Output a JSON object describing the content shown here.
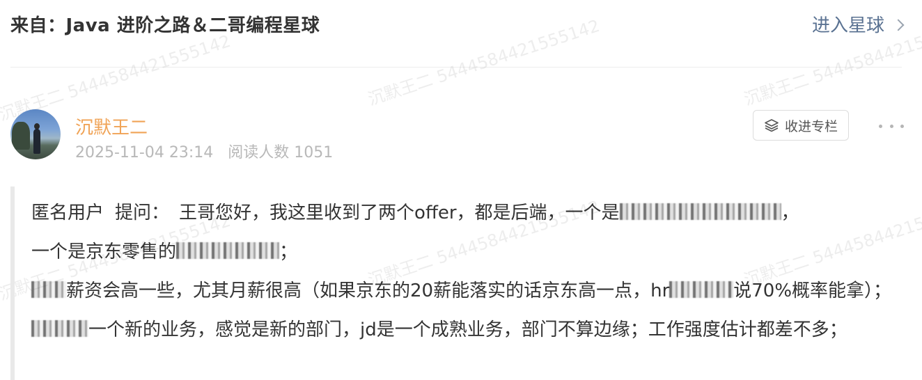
{
  "header": {
    "from_text": "来自：Java 进阶之路＆二哥编程星球",
    "enter_link": "进入星球"
  },
  "watermark": "沉默王二 5444584421555142",
  "post": {
    "author": "沉默王二",
    "date": "2025-11-04 23:14",
    "reads": "阅读人数 1051",
    "collect_button": "收进专栏"
  },
  "question": {
    "asker": "匿名用户",
    "ask_label": "提问：",
    "p1": "王哥您好，我这里收到了两个offer，都是后端，一个是",
    "p2": "，",
    "p3": "一个是京东零售的",
    "p4": "；",
    "p5": "薪资会高一些，尤其月薪很高（如果京东的20薪能落实的话京东高一点，hr",
    "p6": "说70%概率能拿）；",
    "p7": "一个新的业务，感觉是新的部门，jd是一个成熟业务，部门不算边缘；工作强度估计都差不多；"
  },
  "icons": {
    "collect": "layers-icon",
    "more": "more-dots-icon",
    "chevron": "chevron-right-icon"
  },
  "colors": {
    "author": "#f0a356",
    "link": "#5a7292",
    "meta": "#b8b8b8"
  }
}
